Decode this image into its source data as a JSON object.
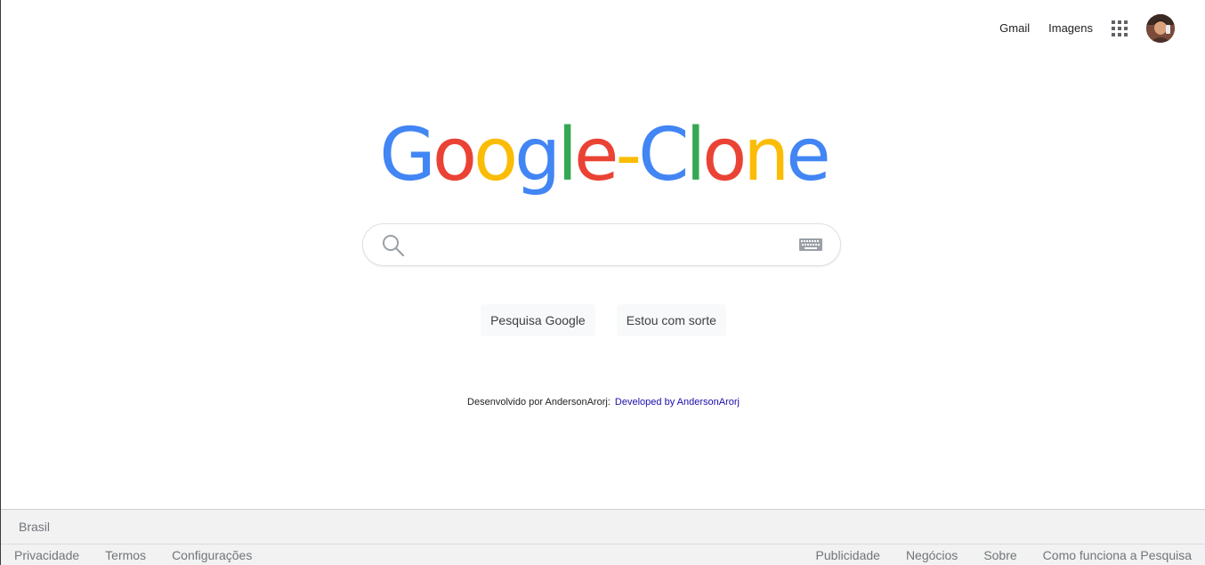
{
  "header": {
    "gmail_label": "Gmail",
    "images_label": "Imagens",
    "apps_icon": "apps-grid-icon",
    "avatar_icon": "user-avatar"
  },
  "logo": {
    "letters": [
      {
        "char": "G",
        "color": "#4285F4"
      },
      {
        "char": "o",
        "color": "#EA4335"
      },
      {
        "char": "o",
        "color": "#FBBC05"
      },
      {
        "char": "g",
        "color": "#4285F4"
      },
      {
        "char": "l",
        "color": "#34A853"
      },
      {
        "char": "e",
        "color": "#EA4335"
      },
      {
        "char": "-",
        "color": "#FBBC05"
      },
      {
        "char": "C",
        "color": "#4285F4"
      },
      {
        "char": "l",
        "color": "#34A853"
      },
      {
        "char": "o",
        "color": "#EA4335"
      },
      {
        "char": "n",
        "color": "#FBBC05"
      },
      {
        "char": "e",
        "color": "#4285F4"
      }
    ]
  },
  "search": {
    "value": "",
    "search_icon": "search-icon",
    "keyboard_icon": "keyboard-icon"
  },
  "buttons": {
    "search_label": "Pesquisa Google",
    "lucky_label": "Estou com sorte"
  },
  "credit": {
    "prefix": "Desenvolvido por AndersonArorj:",
    "link_text": "Developed by AndersonArorj",
    "link_color": "#1a0dab"
  },
  "footer": {
    "country": "Brasil",
    "left_links": [
      "Privacidade",
      "Termos",
      "Configurações"
    ],
    "right_links": [
      "Publicidade",
      "Negócios",
      "Sobre",
      "Como funciona a Pesquisa"
    ]
  }
}
